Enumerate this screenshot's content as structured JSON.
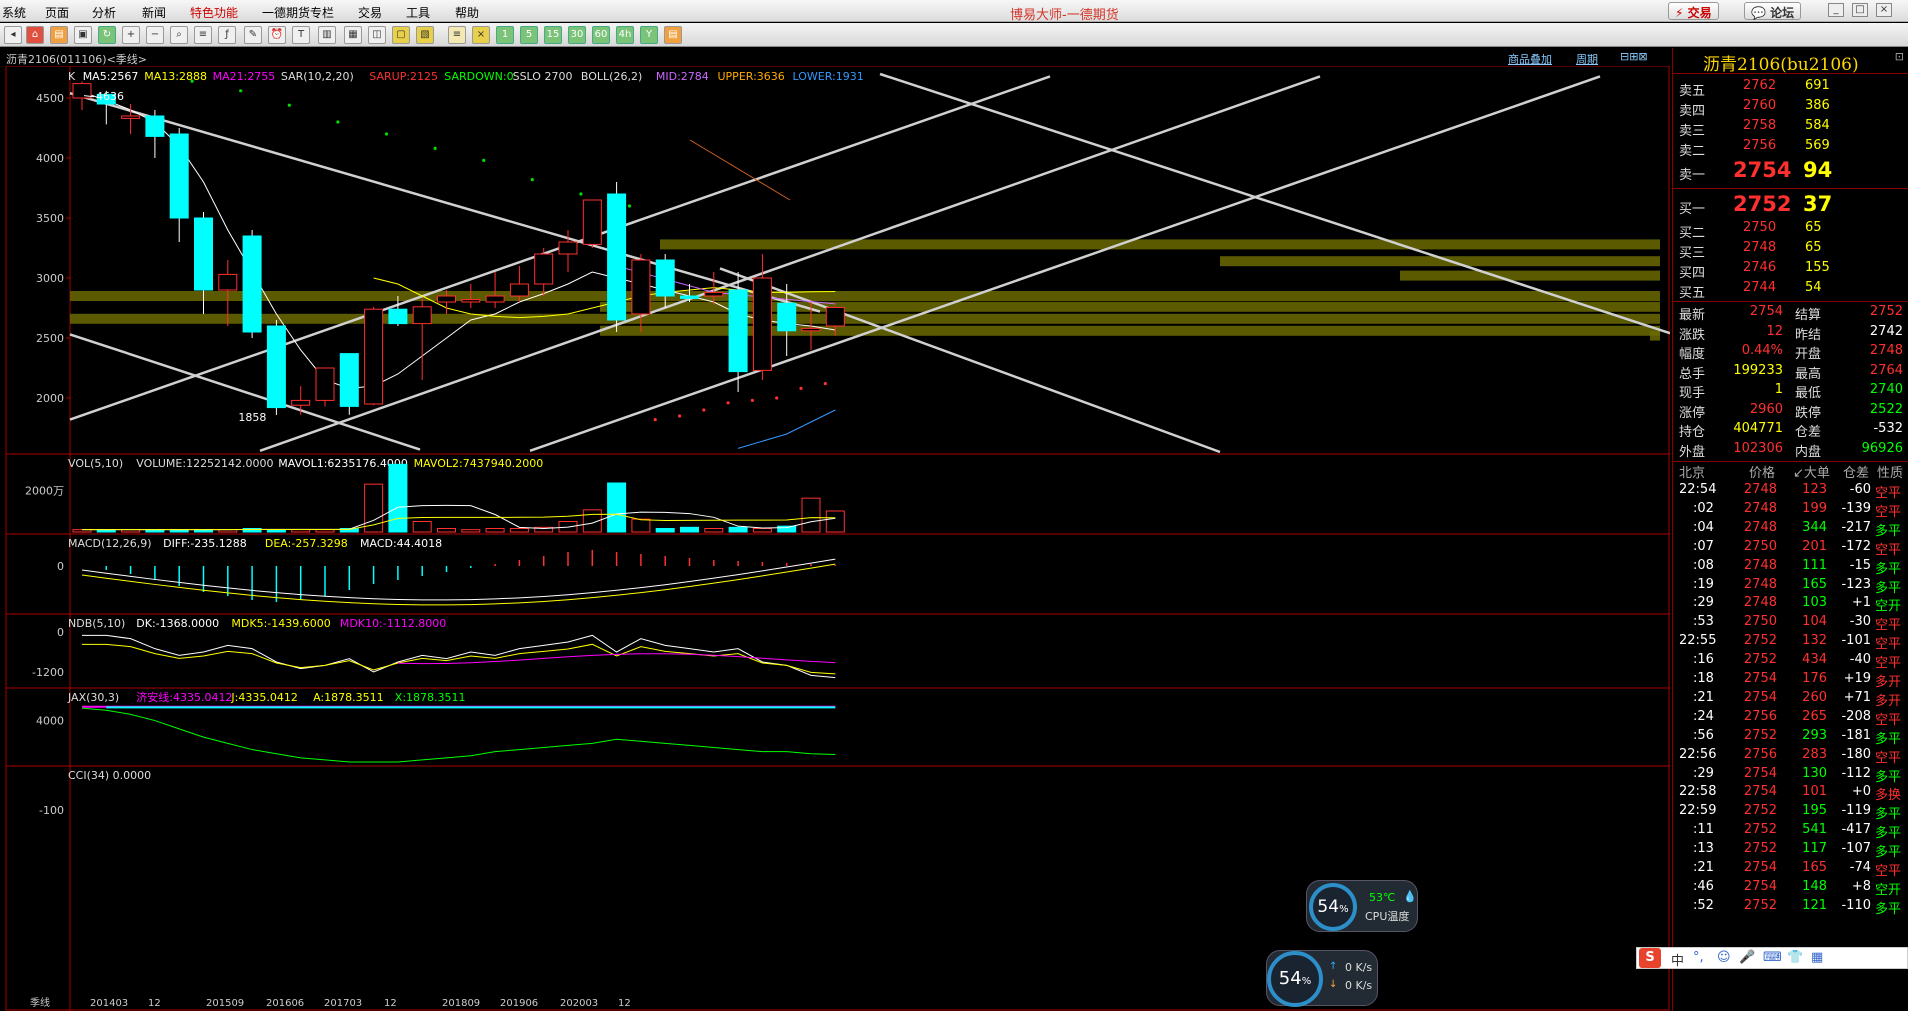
{
  "menu": [
    "系统",
    "页面",
    "分析",
    "新闻",
    "特色功能",
    "一德期货专栏",
    "交易",
    "工具",
    "帮助"
  ],
  "app_title": "博易大师-一德期货",
  "top_buttons": {
    "trade": "交易",
    "forum": "论坛"
  },
  "toolbar_labels": [
    "1",
    "5",
    "15",
    "30",
    "60",
    "4h",
    "Y"
  ],
  "chart_header": {
    "symbol": "沥青2106(011106)<季线>",
    "overlay_link": "商品叠加",
    "period_link": "周期"
  },
  "indicators": {
    "kline": [
      {
        "text": "K",
        "color": "#dddddd"
      },
      {
        "text": "MA5:2567",
        "color": "#ffffff"
      },
      {
        "text": "MA13:2888",
        "color": "#ffff00"
      },
      {
        "text": "MA21:2755",
        "color": "#ff00ff"
      },
      {
        "text": "SAR(10,2,20)",
        "color": "#dddddd"
      },
      {
        "text": "SARUP:2125",
        "color": "#ff3030"
      },
      {
        "text": "SARDOWN:0",
        "color": "#00ff00"
      },
      {
        "text": "SSLO 2700",
        "color": "#dddddd"
      },
      {
        "text": "BOLL(26,2)",
        "color": "#dddddd"
      },
      {
        "text": "MID:2784",
        "color": "#cc66ff"
      },
      {
        "text": "UPPER:3636",
        "color": "#ffaa00"
      },
      {
        "text": "LOWER:1931",
        "color": "#3399ff"
      }
    ],
    "vol": [
      {
        "text": "VOL(5,10)",
        "color": "#dddddd"
      },
      {
        "text": "VOLUME:12252142.0000",
        "color": "#dddddd"
      },
      {
        "text": "MAVOL1:6235176.4000",
        "color": "#ffffff"
      },
      {
        "text": "MAVOL2:7437940.2000",
        "color": "#ffff00"
      }
    ],
    "macd": [
      {
        "text": "MACD(12,26,9)",
        "color": "#dddddd"
      },
      {
        "text": "DIFF:-235.1288",
        "color": "#ffffff"
      },
      {
        "text": "DEA:-257.3298",
        "color": "#ffff00"
      },
      {
        "text": "MACD:44.4018",
        "color": "#ffffff"
      }
    ],
    "ndb": [
      {
        "text": "NDB(5,10)",
        "color": "#dddddd"
      },
      {
        "text": "DK:-1368.0000",
        "color": "#ffffff"
      },
      {
        "text": "MDK5:-1439.6000",
        "color": "#ffff00"
      },
      {
        "text": "MDK10:-1112.8000",
        "color": "#ff00ff"
      }
    ],
    "jax": [
      {
        "text": "JAX(30,3)",
        "color": "#dddddd"
      },
      {
        "text": "济安线:4335.0412",
        "color": "#ff00ff"
      },
      {
        "text": "J:4335.0412",
        "color": "#ffff00"
      },
      {
        "text": "A:1878.3511",
        "color": "#ffff00"
      },
      {
        "text": "X:1878.3511",
        "color": "#00ff00"
      }
    ],
    "cci": [
      {
        "text": "CCI(34) 0.0000",
        "color": "#dddddd"
      }
    ]
  },
  "axis": {
    "price_ticks": [
      "4500",
      "4000",
      "3500",
      "3000",
      "2500",
      "2000"
    ],
    "vol_tick": "2000万",
    "macd_tick": "0",
    "ndb_ticks": [
      "0",
      "-1200"
    ],
    "jax_tick": "4000",
    "cci_tick": "-100",
    "high_label": "4636",
    "low_label": "1858",
    "x_labels": [
      "季线",
      "201403",
      "12",
      "201509",
      "201606",
      "201703",
      "12",
      "201809",
      "201906",
      "202003",
      "12"
    ]
  },
  "chart_data": {
    "type": "candlestick",
    "title": "沥青2106(011106)<季线>",
    "ylim": [
      1550,
      4700
    ],
    "candles": [
      {
        "o": 4500,
        "h": 4636,
        "l": 4400,
        "c": 4620
      },
      {
        "o": 4530,
        "h": 4560,
        "l": 4280,
        "c": 4450
      },
      {
        "o": 4330,
        "h": 4450,
        "l": 4200,
        "c": 4350
      },
      {
        "o": 4350,
        "h": 4400,
        "l": 4000,
        "c": 4180
      },
      {
        "o": 4200,
        "h": 4250,
        "l": 3300,
        "c": 3500
      },
      {
        "o": 3500,
        "h": 3550,
        "l": 2700,
        "c": 2900
      },
      {
        "o": 2900,
        "h": 3150,
        "l": 2600,
        "c": 3030
      },
      {
        "o": 3350,
        "h": 3400,
        "l": 2500,
        "c": 2550
      },
      {
        "o": 2600,
        "h": 2650,
        "l": 1858,
        "c": 1920
      },
      {
        "o": 1940,
        "h": 2100,
        "l": 1860,
        "c": 1980
      },
      {
        "o": 1980,
        "h": 2250,
        "l": 1930,
        "c": 2250
      },
      {
        "o": 2370,
        "h": 2370,
        "l": 1860,
        "c": 1930
      },
      {
        "o": 1950,
        "h": 2760,
        "l": 1940,
        "c": 2740
      },
      {
        "o": 2740,
        "h": 2850,
        "l": 2600,
        "c": 2620
      },
      {
        "o": 2620,
        "h": 2830,
        "l": 2150,
        "c": 2760
      },
      {
        "o": 2800,
        "h": 2900,
        "l": 2700,
        "c": 2850
      },
      {
        "o": 2800,
        "h": 2950,
        "l": 2750,
        "c": 2820
      },
      {
        "o": 2800,
        "h": 3050,
        "l": 2750,
        "c": 2850
      },
      {
        "o": 2850,
        "h": 3100,
        "l": 2800,
        "c": 2950
      },
      {
        "o": 2950,
        "h": 3250,
        "l": 2850,
        "c": 3200
      },
      {
        "o": 3200,
        "h": 3400,
        "l": 3050,
        "c": 3300
      },
      {
        "o": 3280,
        "h": 3650,
        "l": 3250,
        "c": 3650
      },
      {
        "o": 3700,
        "h": 3800,
        "l": 2550,
        "c": 2650
      },
      {
        "o": 2700,
        "h": 3200,
        "l": 2550,
        "c": 3150
      },
      {
        "o": 3150,
        "h": 3200,
        "l": 2750,
        "c": 2850
      },
      {
        "o": 2850,
        "h": 2950,
        "l": 2800,
        "c": 2830
      },
      {
        "o": 2850,
        "h": 3050,
        "l": 2780,
        "c": 2880
      },
      {
        "o": 2900,
        "h": 3050,
        "l": 2050,
        "c": 2220
      },
      {
        "o": 2230,
        "h": 3200,
        "l": 2150,
        "c": 3000
      },
      {
        "o": 2790,
        "h": 2950,
        "l": 2350,
        "c": 2560
      },
      {
        "o": 2560,
        "h": 2800,
        "l": 2400,
        "c": 2580
      },
      {
        "o": 2600,
        "h": 2764,
        "l": 2520,
        "c": 2754
      }
    ],
    "ma5": [
      4550,
      4480,
      4400,
      4300,
      4100,
      3800,
      3400,
      3050,
      2700,
      2400,
      2150,
      2080,
      2100,
      2200,
      2350,
      2500,
      2650,
      2700,
      2800,
      2870,
      2950,
      3050,
      3000,
      2950,
      2900,
      2850,
      2800,
      2700,
      2650,
      2620,
      2600,
      2567
    ],
    "ma13": [
      null,
      null,
      null,
      null,
      null,
      null,
      null,
      null,
      null,
      null,
      null,
      null,
      3000,
      2950,
      2850,
      2750,
      2700,
      2680,
      2670,
      2680,
      2700,
      2750,
      2800,
      2850,
      2880,
      2900,
      2920,
      2900,
      2880,
      2880,
      2885,
      2888
    ],
    "volume": [
      0.2,
      0.2,
      0.2,
      0.2,
      0.2,
      0.2,
      0.2,
      0.3,
      0.2,
      0.2,
      0.2,
      0.3,
      4.1,
      5.8,
      0.9,
      0.3,
      0.2,
      0.3,
      0.3,
      0.4,
      0.9,
      1.9,
      4.2,
      1.1,
      0.3,
      0.4,
      0.3,
      0.4,
      0.3,
      0.5,
      2.9,
      1.8
    ],
    "macd_bars": [
      0,
      -20,
      -40,
      -70,
      -100,
      -130,
      -150,
      -170,
      -180,
      -170,
      -150,
      -120,
      -90,
      -70,
      -50,
      -30,
      -10,
      10,
      30,
      50,
      70,
      80,
      70,
      60,
      50,
      40,
      30,
      25,
      20,
      15,
      10,
      5
    ],
    "jax_green": [
      4300,
      4250,
      4150,
      4000,
      3800,
      3600,
      3450,
      3300,
      3200,
      3100,
      3050,
      3000,
      3000,
      3000,
      3050,
      3100,
      3150,
      3250,
      3300,
      3350,
      3400,
      3450,
      3550,
      3500,
      3450,
      3400,
      3350,
      3300,
      3250,
      3250,
      3200,
      3180
    ],
    "bands": [
      2850,
      2760,
      2660,
      2560,
      3140,
      3020,
      3280,
      2520
    ]
  },
  "right_panel": {
    "title": "沥青2106(bu2106)",
    "asks": [
      {
        "label": "卖五",
        "price": "2762",
        "vol": "691"
      },
      {
        "label": "卖四",
        "price": "2760",
        "vol": "386"
      },
      {
        "label": "卖三",
        "price": "2758",
        "vol": "584"
      },
      {
        "label": "卖二",
        "price": "2756",
        "vol": "569"
      },
      {
        "label": "卖一",
        "price": "2754",
        "vol": "94"
      }
    ],
    "bids": [
      {
        "label": "买一",
        "price": "2752",
        "vol": "37"
      },
      {
        "label": "买二",
        "price": "2750",
        "vol": "65"
      },
      {
        "label": "买三",
        "price": "2748",
        "vol": "65"
      },
      {
        "label": "买四",
        "price": "2746",
        "vol": "155"
      },
      {
        "label": "买五",
        "price": "2744",
        "vol": "54"
      }
    ],
    "stats": [
      {
        "l1": "最新",
        "v1": "2754",
        "c1": "#ff3030",
        "l2": "结算",
        "v2": "2752",
        "c2": "#ff3030"
      },
      {
        "l1": "涨跌",
        "v1": "12",
        "c1": "#ff3030",
        "l2": "昨结",
        "v2": "2742",
        "c2": "#ffffff"
      },
      {
        "l1": "幅度",
        "v1": "0.44%",
        "c1": "#ff3030",
        "l2": "开盘",
        "v2": "2748",
        "c2": "#ff3030"
      },
      {
        "l1": "总手",
        "v1": "199233",
        "c1": "#ffff00",
        "l2": "最高",
        "v2": "2764",
        "c2": "#ff3030"
      },
      {
        "l1": "现手",
        "v1": "1",
        "c1": "#ffff00",
        "l2": "最低",
        "v2": "2740",
        "c2": "#00ff00"
      },
      {
        "l1": "涨停",
        "v1": "2960",
        "c1": "#ff3030",
        "l2": "跌停",
        "v2": "2522",
        "c2": "#00ff00"
      },
      {
        "l1": "持仓",
        "v1": "404771",
        "c1": "#ffff00",
        "l2": "仓差",
        "v2": "-532",
        "c2": "#ffffff"
      },
      {
        "l1": "外盘",
        "v1": "102306",
        "c1": "#ff3030",
        "l2": "内盘",
        "v2": "96926",
        "c2": "#00ff00"
      }
    ],
    "tick_header": {
      "time": "北京",
      "price": "价格",
      "vol": "↙大单",
      "oi": "仓差",
      "nature": "性质"
    },
    "ticks": [
      {
        "t": "22:54",
        "p": "2748",
        "v": "123",
        "o": "-60",
        "n": "空平",
        "nc": "#ff3030"
      },
      {
        "t": ":02",
        "p": "2748",
        "v": "199",
        "o": "-139",
        "n": "空平",
        "nc": "#ff3030"
      },
      {
        "t": ":04",
        "p": "2748",
        "v": "344",
        "o": "-217",
        "n": "多平",
        "nc": "#00ff00"
      },
      {
        "t": ":07",
        "p": "2750",
        "v": "201",
        "o": "-172",
        "n": "空平",
        "nc": "#ff3030"
      },
      {
        "t": ":08",
        "p": "2748",
        "v": "111",
        "o": "-15",
        "n": "多平",
        "nc": "#00ff00"
      },
      {
        "t": ":19",
        "p": "2748",
        "v": "165",
        "o": "-123",
        "n": "多平",
        "nc": "#00ff00"
      },
      {
        "t": ":29",
        "p": "2748",
        "v": "103",
        "o": "+1",
        "n": "空开",
        "nc": "#00ff00"
      },
      {
        "t": ":53",
        "p": "2750",
        "v": "104",
        "o": "-30",
        "n": "空平",
        "nc": "#ff3030"
      },
      {
        "t": "22:55",
        "p": "2752",
        "v": "132",
        "o": "-101",
        "n": "空平",
        "nc": "#ff3030"
      },
      {
        "t": ":16",
        "p": "2752",
        "v": "434",
        "o": "-40",
        "n": "空平",
        "nc": "#ff3030"
      },
      {
        "t": ":18",
        "p": "2754",
        "v": "176",
        "o": "+19",
        "n": "多开",
        "nc": "#ff3030"
      },
      {
        "t": ":21",
        "p": "2754",
        "v": "260",
        "o": "+71",
        "n": "多开",
        "nc": "#ff3030"
      },
      {
        "t": ":24",
        "p": "2756",
        "v": "265",
        "o": "-208",
        "n": "空平",
        "nc": "#ff3030"
      },
      {
        "t": ":56",
        "p": "2752",
        "v": "293",
        "o": "-181",
        "n": "多平",
        "nc": "#00ff00"
      },
      {
        "t": "22:56",
        "p": "2756",
        "v": "283",
        "o": "-180",
        "n": "空平",
        "nc": "#ff3030"
      },
      {
        "t": ":29",
        "p": "2754",
        "v": "130",
        "o": "-112",
        "n": "多平",
        "nc": "#00ff00"
      },
      {
        "t": "22:58",
        "p": "2754",
        "v": "101",
        "o": "+0",
        "n": "多换",
        "nc": "#ff3030"
      },
      {
        "t": "22:59",
        "p": "2752",
        "v": "195",
        "o": "-119",
        "n": "多平",
        "nc": "#00ff00"
      },
      {
        "t": ":11",
        "p": "2752",
        "v": "541",
        "o": "-417",
        "n": "多平",
        "nc": "#00ff00"
      },
      {
        "t": ":13",
        "p": "2752",
        "v": "117",
        "o": "-107",
        "n": "多平",
        "nc": "#00ff00"
      },
      {
        "t": ":21",
        "p": "2754",
        "v": "165",
        "o": "-74",
        "n": "空平",
        "nc": "#ff3030"
      },
      {
        "t": ":46",
        "p": "2754",
        "v": "148",
        "o": "+8",
        "n": "空开",
        "nc": "#00ff00"
      },
      {
        "t": ":52",
        "p": "2752",
        "v": "121",
        "o": "-110",
        "n": "多平",
        "nc": "#00ff00"
      }
    ]
  },
  "widgets": {
    "cpu_percent": "54",
    "cpu_unit": "%",
    "cpu_temp": "53℃",
    "cpu_temp_label": "CPU温度",
    "net_percent": "54",
    "net_up": "0 K/s",
    "net_down": "0 K/s"
  },
  "ime": {
    "logo": "S",
    "lang": "中"
  }
}
